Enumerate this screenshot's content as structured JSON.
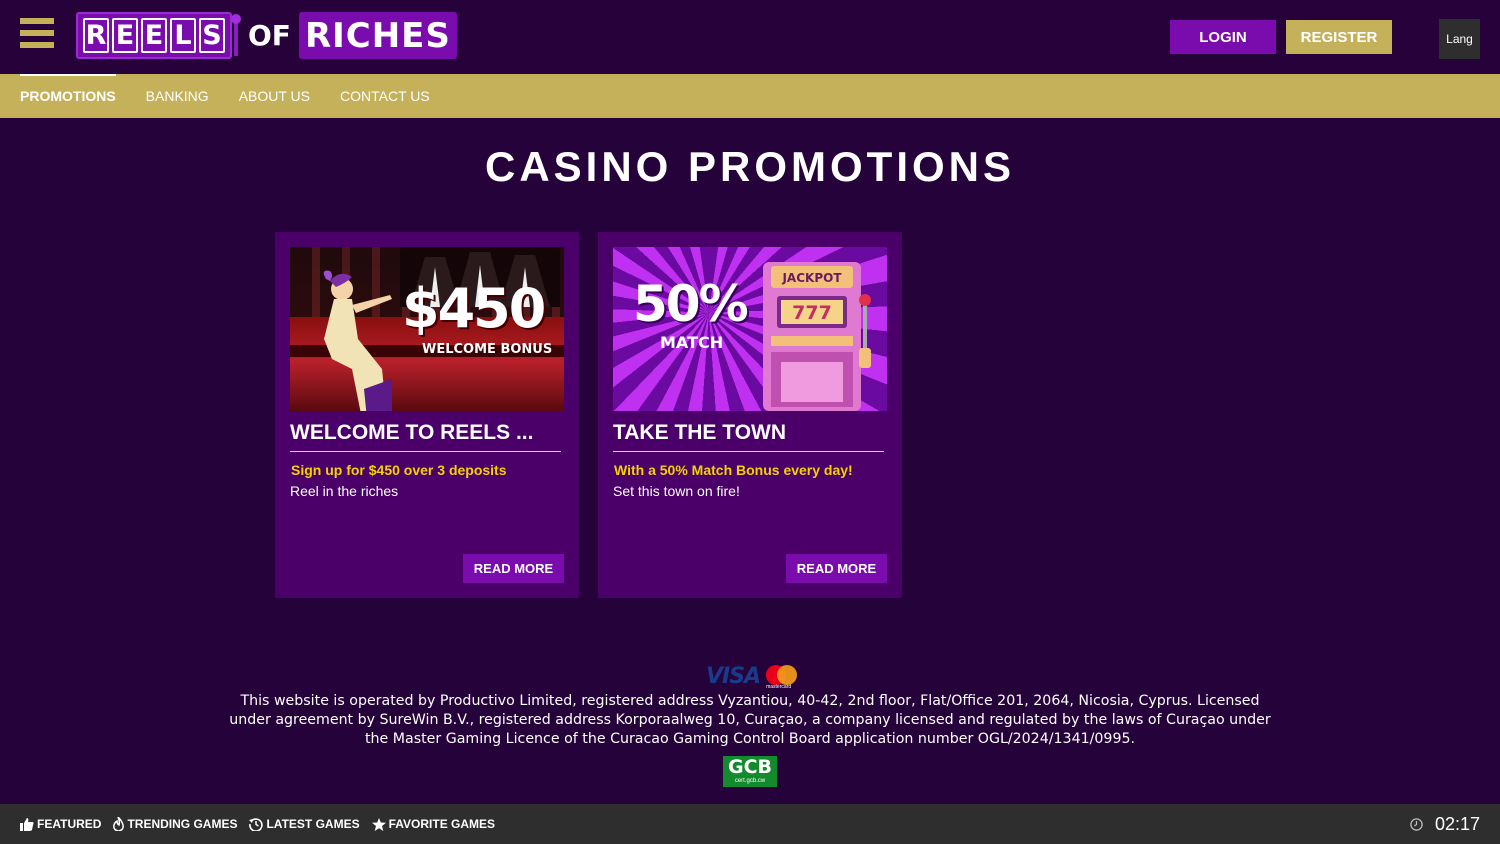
{
  "header": {
    "logo": {
      "word1": "REELS",
      "word2": "OF",
      "word3": "RICHES"
    },
    "login_label": "LOGIN",
    "register_label": "REGISTER",
    "lang_label": "Lang"
  },
  "nav": {
    "items": [
      {
        "label": "PROMOTIONS",
        "active": true
      },
      {
        "label": "BANKING"
      },
      {
        "label": "ABOUT US"
      },
      {
        "label": "CONTACT US"
      }
    ]
  },
  "main": {
    "title": "CASINO PROMOTIONS",
    "promos": [
      {
        "image": {
          "amount": "$450",
          "caption": "WELCOME BONUS"
        },
        "title": "WELCOME TO REELS ...",
        "subtitle": "Sign up for $450 over 3 deposits",
        "description": "Reel in the riches",
        "button_label": "READ MORE"
      },
      {
        "image": {
          "amount": "50%",
          "caption": "MATCH",
          "slot_sign": "JACKPOT",
          "slot_reels": "777"
        },
        "title": "TAKE THE TOWN",
        "subtitle": "With a 50% Match Bonus every day!",
        "description": "Set this town on fire!",
        "button_label": "READ MORE"
      }
    ]
  },
  "footer": {
    "payment": {
      "visa": "VISA",
      "mastercard": "mastercard"
    },
    "legal_text": "This website is operated by Productivo Limited, registered address Vyzantiou, 40-42, 2nd floor, Flat/Office 201, 2064, Nicosia, Cyprus. Licensed under agreement by SureWin B.V., registered address Korporaalweg 10, Curaçao, a company licensed and regulated by the laws of Curaçao under the Master Gaming Licence of the Curacao Gaming Control Board application number OGL/2024/1341/0995.",
    "license_badge": {
      "title": "GCB",
      "subtitle": "cert.gcb.cw"
    }
  },
  "bottom_bar": {
    "items": [
      {
        "label": "FEATURED",
        "icon": "thumbs-up-icon"
      },
      {
        "label": "TRENDING GAMES",
        "icon": "flame-icon"
      },
      {
        "label": "LATEST GAMES",
        "icon": "history-icon"
      },
      {
        "label": "FAVORITE GAMES",
        "icon": "star-icon"
      }
    ],
    "clock_icon": "clock-icon",
    "time": "02:17"
  },
  "colors": {
    "background": "#26023a",
    "accent_purple": "#7a0cae",
    "gold": "#c5b15a",
    "card_bg": "#4a0068",
    "promo_yellow": "#f5d100",
    "bottom_bar": "#2e2e2e"
  }
}
